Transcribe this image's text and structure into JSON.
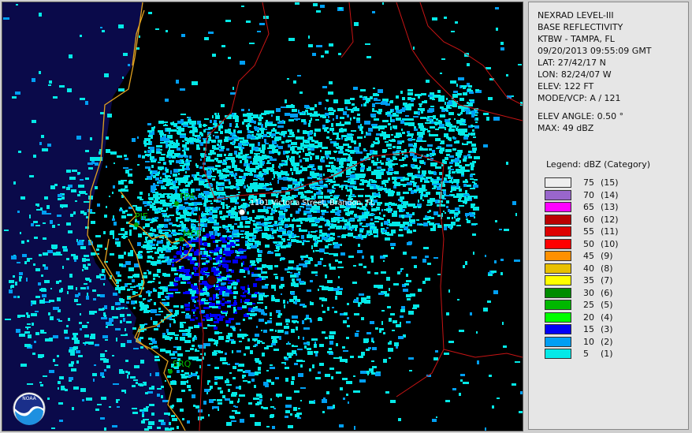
{
  "panel": {
    "lines": [
      "NEXRAD LEVEL-III",
      "BASE REFLECTIVITY",
      "KTBW - TAMPA, FL",
      "09/20/2013 09:55:09 GMT",
      "LAT: 27/42/17 N",
      "LON: 82/24/07 W",
      "ELEV: 122 FT",
      "MODE/VCP: A / 121"
    ],
    "lines2": [
      "ELEV ANGLE: 0.50 °",
      "MAX: 49 dBZ"
    ]
  },
  "legend": {
    "title": "Legend: dBZ (Category)",
    "items": [
      {
        "dbz": "75",
        "cat": "(15)",
        "color": "#eeeeee"
      },
      {
        "dbz": "70",
        "cat": "(14)",
        "color": "#9966cc"
      },
      {
        "dbz": "65",
        "cat": "(13)",
        "color": "#ff00ff"
      },
      {
        "dbz": "60",
        "cat": "(12)",
        "color": "#bb0000"
      },
      {
        "dbz": "55",
        "cat": "(11)",
        "color": "#dd0000"
      },
      {
        "dbz": "50",
        "cat": "(10)",
        "color": "#ff0000"
      },
      {
        "dbz": "45",
        "cat": "(9)",
        "color": "#ff9000"
      },
      {
        "dbz": "40",
        "cat": "(8)",
        "color": "#e8c000"
      },
      {
        "dbz": "35",
        "cat": "(7)",
        "color": "#ffff00"
      },
      {
        "dbz": "30",
        "cat": "(6)",
        "color": "#008c00"
      },
      {
        "dbz": "25",
        "cat": "(5)",
        "color": "#00b800"
      },
      {
        "dbz": "20",
        "cat": "(4)",
        "color": "#00ff00"
      },
      {
        "dbz": "15",
        "cat": "(3)",
        "color": "#0000f6"
      },
      {
        "dbz": "10",
        "cat": "(2)",
        "color": "#019ff4"
      },
      {
        "dbz": "5",
        "cat": "(1)",
        "color": "#04e9e7"
      }
    ]
  },
  "map": {
    "location_label": "1101 Victoria Street, Brandon, FL",
    "airports": [
      "TPA",
      "PIE",
      "MCF",
      "SRQ"
    ],
    "logo_text": "NOAA"
  }
}
